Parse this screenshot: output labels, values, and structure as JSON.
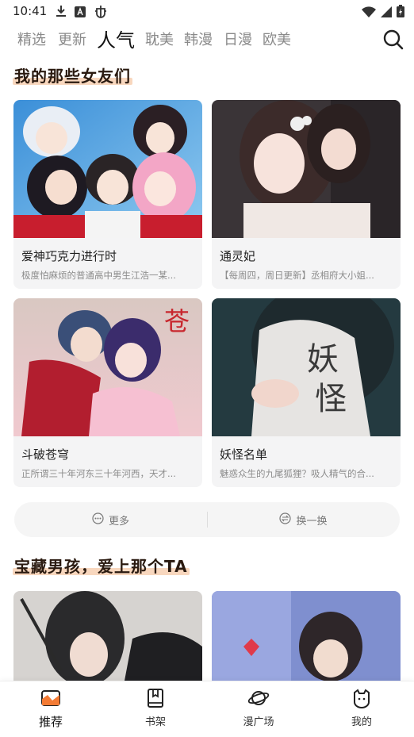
{
  "status": {
    "time": "10:41",
    "left_icons": [
      "download-icon",
      "a-icon",
      "bug-icon"
    ],
    "right_icons": [
      "wifi-icon",
      "signal-icon",
      "battery-icon"
    ]
  },
  "tabs": [
    {
      "label": "精选",
      "active": false
    },
    {
      "label": "更新",
      "active": false
    },
    {
      "label": "人气",
      "active": true
    },
    {
      "label": "耽美",
      "active": false
    },
    {
      "label": "韩漫",
      "active": false
    },
    {
      "label": "日漫",
      "active": false
    },
    {
      "label": "欧美",
      "active": false
    }
  ],
  "sections": [
    {
      "title": "我的那些女友们",
      "cards": [
        {
          "name": "爱神巧克力进行时",
          "desc": "极度怕麻烦的普通高中男生江浩一某..."
        },
        {
          "name": "通灵妃",
          "desc": "【每周四，周日更新】丞相府大小姐..."
        },
        {
          "name": "斗破苍穹",
          "desc": "正所谓三十年河东三十年河西，天才..."
        },
        {
          "name": "妖怪名单",
          "desc": "魅惑众生的九尾狐狸？吸人精气的合..."
        }
      ]
    },
    {
      "title": "宝藏男孩，爱上那个TA",
      "cards": []
    }
  ],
  "more_bar": {
    "more_label": "更多",
    "refresh_label": "换一换"
  },
  "bottom_nav": [
    {
      "label": "推荐",
      "icon": "recommend-icon",
      "active": true
    },
    {
      "label": "书架",
      "icon": "bookshelf-icon",
      "active": false
    },
    {
      "label": "漫广场",
      "icon": "planet-icon",
      "active": false
    },
    {
      "label": "我的",
      "icon": "profile-icon",
      "active": false
    }
  ],
  "colors": {
    "title_highlight": "#f6c9a8",
    "card_bg": "#f4f4f5",
    "muted_text": "#8c8c8c"
  }
}
